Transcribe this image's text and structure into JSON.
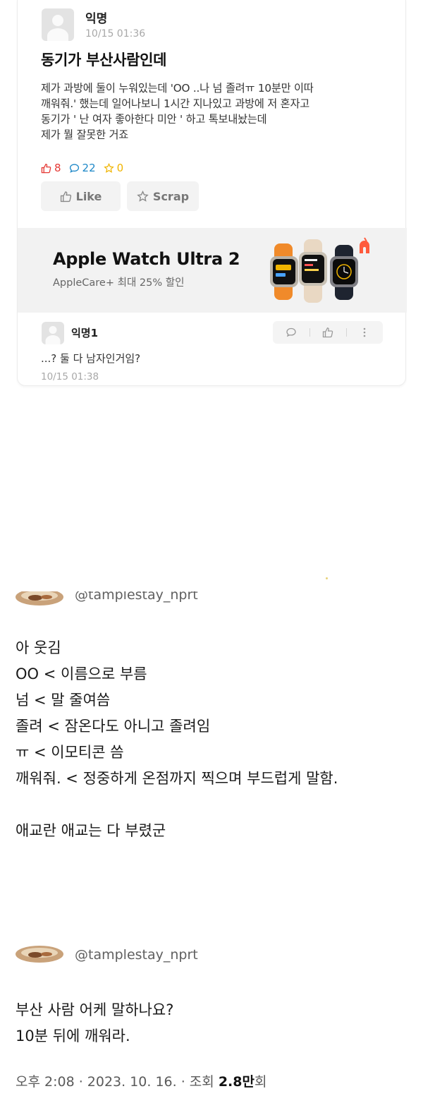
{
  "post": {
    "author": "익명",
    "time": "10/15 01:36",
    "title": "동기가 부산사람인데",
    "body_lines": [
      "제가 과방에 둘이 누워있는데 'OO ..나 넘 졸려ㅠ 10분만 이따",
      "깨워줘.' 했는데 일어나보니 1시간 지나있고 과방에 저 혼자고",
      "동기가 ' 난 여자 좋아한다 미안 ' 하고 톡보내놨는데",
      "제가 뭘 잘못한 거죠"
    ],
    "likes": "8",
    "comments": "22",
    "scraps": "0",
    "like_label": "Like",
    "scrap_label": "Scrap",
    "colors": {
      "like": "#e53935",
      "comment": "#1e88c8",
      "scrap": "#f0b400"
    }
  },
  "ad": {
    "title": "Apple Watch Ultra 2",
    "subtitle": "AppleCare+ 최대 25% 할인"
  },
  "comment": {
    "author": "익명1",
    "text": "...? 둘 다 남자인거임?",
    "time": "10/15 01:38"
  },
  "tweet1": {
    "handle": "@tamplestay_nprt",
    "lines": [
      "아 웃김",
      "OO < 이름으로 부름",
      "넘 < 말 줄여씀",
      "졸려 < 잠온다도 아니고 졸려임",
      "ㅠ < 이모티콘 씀",
      "깨워줘. < 정중하게 온점까지 찍으며 부드럽게 말함.",
      "",
      "애교란 애교는 다 부렸군"
    ]
  },
  "tweet2": {
    "handle": "@tamplestay_nprt",
    "lines": [
      "부산 사람 어케 말하나요?",
      "10분 뒤에 깨워라."
    ]
  },
  "footer": {
    "time": "오후 2:08 · 2023. 10. 16. · 조회 ",
    "views": "2.8만",
    "views_suffix": "회"
  }
}
